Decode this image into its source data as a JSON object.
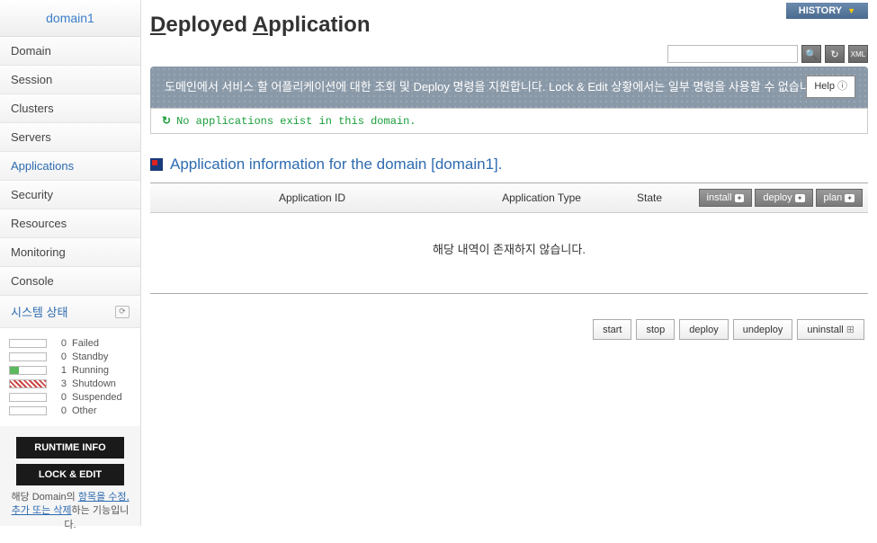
{
  "sidebar": {
    "domain": "domain1",
    "nav": [
      {
        "label": "Domain"
      },
      {
        "label": "Session"
      },
      {
        "label": "Clusters"
      },
      {
        "label": "Servers"
      },
      {
        "label": "Applications",
        "active": true
      },
      {
        "label": "Security"
      },
      {
        "label": "Resources"
      },
      {
        "label": "Monitoring"
      },
      {
        "label": "Console"
      }
    ],
    "system_status_label": "시스템 상태",
    "statuses": [
      {
        "count": "0",
        "label": "Failed",
        "cls": ""
      },
      {
        "count": "0",
        "label": "Standby",
        "cls": ""
      },
      {
        "count": "1",
        "label": "Running",
        "cls": "running"
      },
      {
        "count": "3",
        "label": "Shutdown",
        "cls": "shutdown"
      },
      {
        "count": "0",
        "label": "Suspended",
        "cls": ""
      },
      {
        "count": "0",
        "label": "Other",
        "cls": ""
      }
    ],
    "runtime_btn": "RUNTIME INFO",
    "lockedit_btn": "LOCK & EDIT",
    "desc_pre": "해당 Domain의 ",
    "desc_link": "항목을 수정, 추가 또는 삭제",
    "desc_post": "하는 기능입니다."
  },
  "header": {
    "history": "HISTORY",
    "title_d": "D",
    "title_rest1": "eployed ",
    "title_a": "A",
    "title_rest2": "pplication"
  },
  "banner": {
    "text": "도메인에서 서비스 할 어플리케이션에 대한 조회 및 Deploy 명령을 지원합니다. Lock & Edit 상황에서는 일부 명령을 사용할 수 없습니다.",
    "help": "Help"
  },
  "status_message": "No applications exist in this domain.",
  "section_title": "Application information for the domain [domain1].",
  "table": {
    "col_appid": "Application ID",
    "col_type": "Application Type",
    "col_state": "State",
    "install": "install",
    "deploy": "deploy",
    "plan": "plan",
    "empty": "해당 내역이 존재하지 않습니다."
  },
  "actions": {
    "start": "start",
    "stop": "stop",
    "deploy": "deploy",
    "undeploy": "undeploy",
    "uninstall": "uninstall"
  }
}
